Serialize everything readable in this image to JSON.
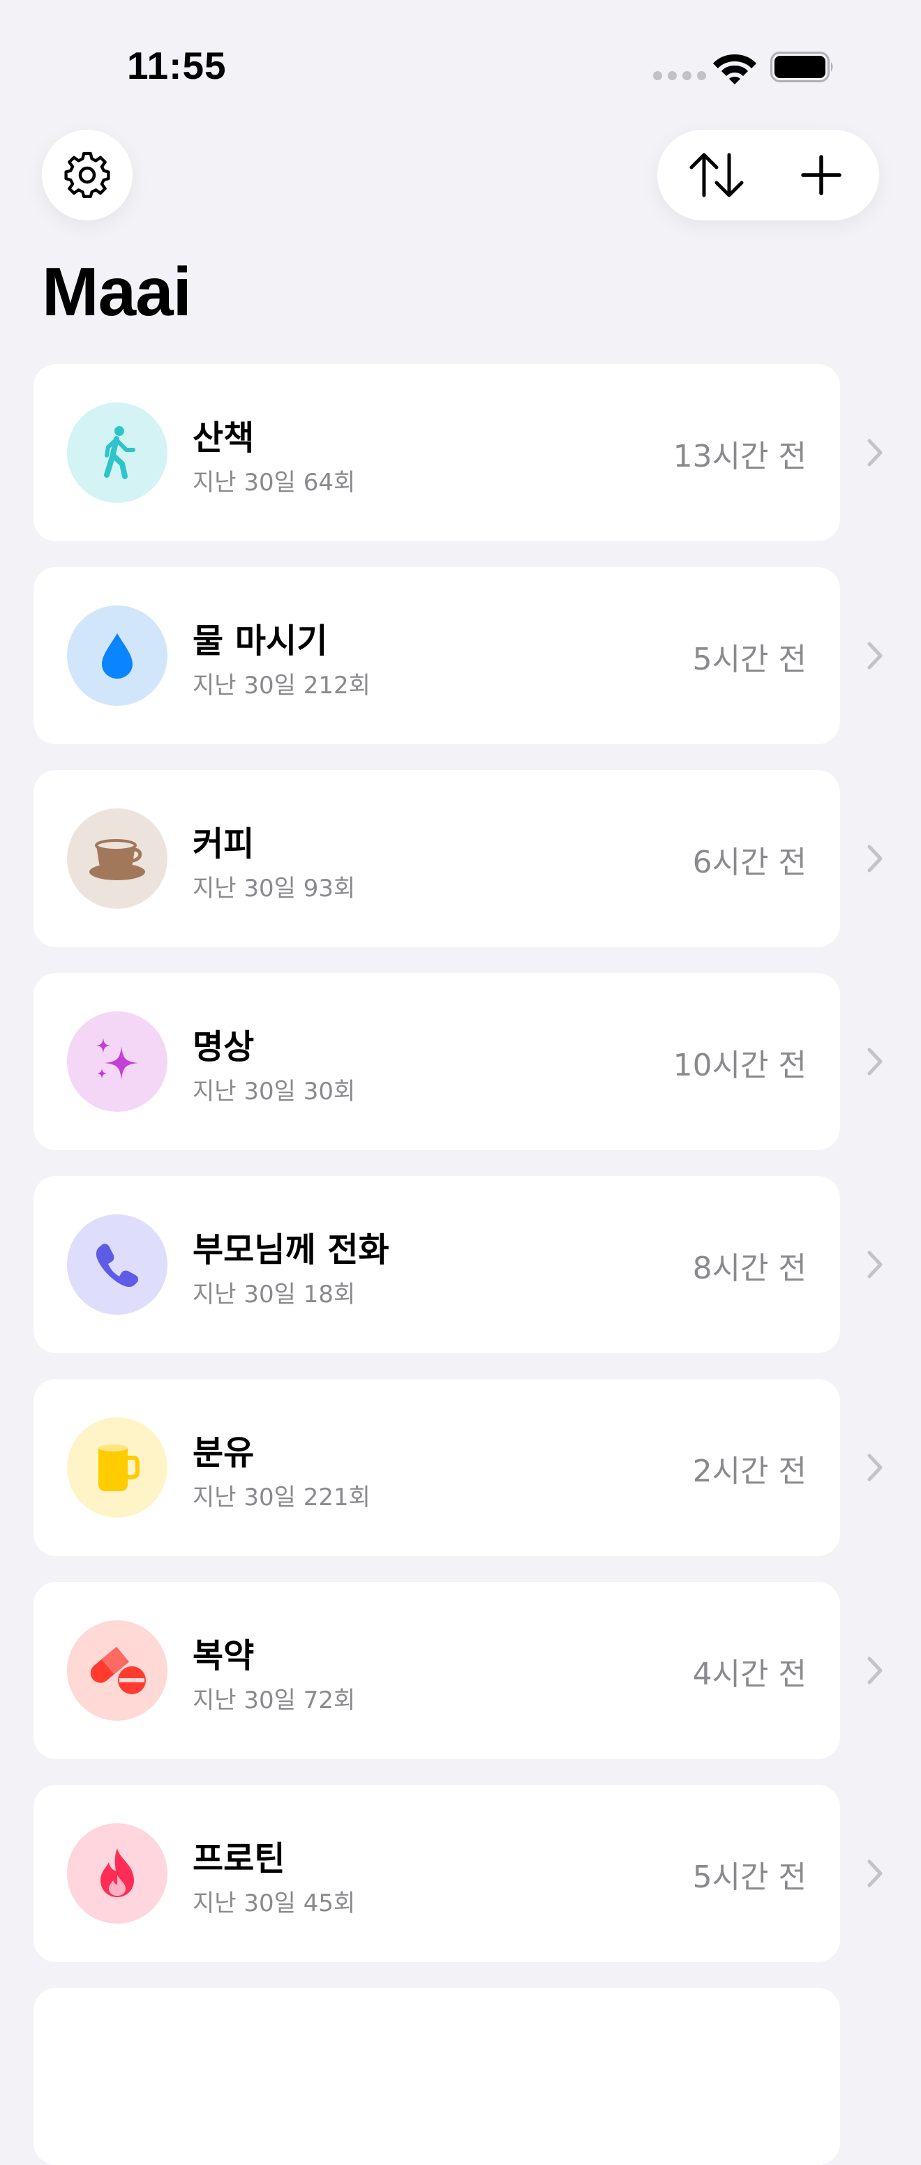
{
  "status_bar": {
    "time": "11:55"
  },
  "header": {
    "settings_icon": "gear-icon",
    "sort_icon": "arrow-up-down-icon",
    "add_icon": "plus-icon",
    "title": "Maai"
  },
  "colors": {
    "background": "#F2F2F7",
    "card": "#FFFFFF",
    "secondary_text": "#8A8A8E"
  },
  "items": [
    {
      "name": "산책",
      "sub": "지난 30일 64회",
      "ago": "13시간 전",
      "icon": "walking-figure-icon",
      "icon_color": "#2EC4C9",
      "bg": "#D3F3F5"
    },
    {
      "name": "물 마시기",
      "sub": "지난 30일 212회",
      "ago": "5시간 전",
      "icon": "water-drop-icon",
      "icon_color": "#0A84FF",
      "bg": "#D2E6FB"
    },
    {
      "name": "커피",
      "sub": "지난 30일 93회",
      "ago": "6시간 전",
      "icon": "coffee-cup-icon",
      "icon_color": "#A2785A",
      "bg": "#EDE3DD"
    },
    {
      "name": "명상",
      "sub": "지난 30일 30회",
      "ago": "10시간 전",
      "icon": "sparkles-icon",
      "icon_color": "#C43FD6",
      "bg": "#F4D7F6"
    },
    {
      "name": "부모님께 전화",
      "sub": "지난 30일 18회",
      "ago": "8시간 전",
      "icon": "phone-icon",
      "icon_color": "#5E5CE6",
      "bg": "#DEDDFB"
    },
    {
      "name": "분유",
      "sub": "지난 30일 221회",
      "ago": "2시간 전",
      "icon": "mug-icon",
      "icon_color": "#FFCC00",
      "bg": "#FFF4C7"
    },
    {
      "name": "복약",
      "sub": "지난 30일 72회",
      "ago": "4시간 전",
      "icon": "pills-icon",
      "icon_color": "#FF3B30",
      "bg": "#FFD9D6"
    },
    {
      "name": "프로틴",
      "sub": "지난 30일 45회",
      "ago": "5시간 전",
      "icon": "flame-icon",
      "icon_color": "#FF2D55",
      "bg": "#FFD6DE"
    }
  ]
}
